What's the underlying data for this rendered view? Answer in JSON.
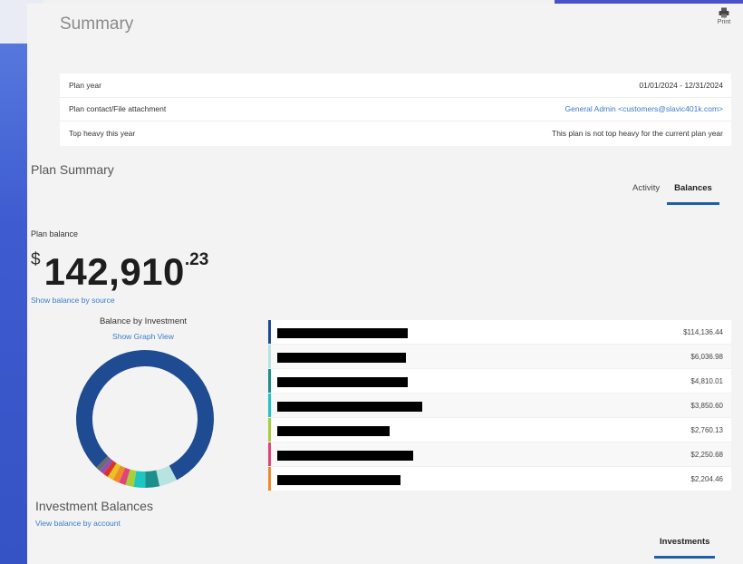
{
  "header": {
    "title": "Summary",
    "print_label": "Print"
  },
  "info": [
    {
      "label": "Plan year",
      "value": "01/01/2024 - 12/31/2024",
      "is_link": false
    },
    {
      "label": "Plan contact/File attachment",
      "value": "General Admin <customers@slavic401k.com>",
      "is_link": true
    },
    {
      "label": "Top heavy this year",
      "value": "This plan is not top heavy for the current plan year",
      "is_link": false
    }
  ],
  "plan_summary": {
    "title": "Plan Summary",
    "tabs": [
      {
        "label": "Activity",
        "active": false
      },
      {
        "label": "Balances",
        "active": true
      }
    ],
    "balance_label": "Plan balance",
    "balance_currency": "$",
    "balance_whole": "142,910",
    "balance_cents": ".23",
    "show_by_source": "Show balance by source"
  },
  "chart": {
    "title": "Balance by Investment",
    "graph_link": "Show Graph View"
  },
  "chart_data": {
    "type": "pie",
    "title": "Balance by Investment",
    "series": [
      {
        "value": 114136.44,
        "color": "#1f4b93"
      },
      {
        "value": 6036.98,
        "color": "#b8e3e0"
      },
      {
        "value": 4810.01,
        "color": "#1b8f8c"
      },
      {
        "value": 3850.6,
        "color": "#1ec6c2"
      },
      {
        "value": 2760.13,
        "color": "#a7cf3a"
      },
      {
        "value": 2250.68,
        "color": "#e0457a"
      },
      {
        "value": 2204.46,
        "color": "#f08a2a"
      },
      {
        "value": 2000,
        "color": "#e8c21f"
      },
      {
        "value": 1800,
        "color": "#d9342b"
      },
      {
        "value": 1500,
        "color": "#8f4fb8"
      },
      {
        "value": 1561.93,
        "color": "#6b6b6b"
      }
    ]
  },
  "investments": {
    "title": "Investment Balances",
    "view_by_account": "View balance by account",
    "tab_label": "Investments",
    "rows": [
      {
        "amount": "$114,136.44",
        "color": "#1f4b93"
      },
      {
        "amount": "$6,036.98",
        "color": "#b8e3e0"
      },
      {
        "amount": "$4,810.01",
        "color": "#1b8f8c"
      },
      {
        "amount": "$3,850.60",
        "color": "#1ec6c2"
      },
      {
        "amount": "$2,760.13",
        "color": "#a7cf3a"
      },
      {
        "amount": "$2,250.68",
        "color": "#e0457a"
      },
      {
        "amount": "$2,204.46",
        "color": "#f08a2a"
      }
    ]
  }
}
